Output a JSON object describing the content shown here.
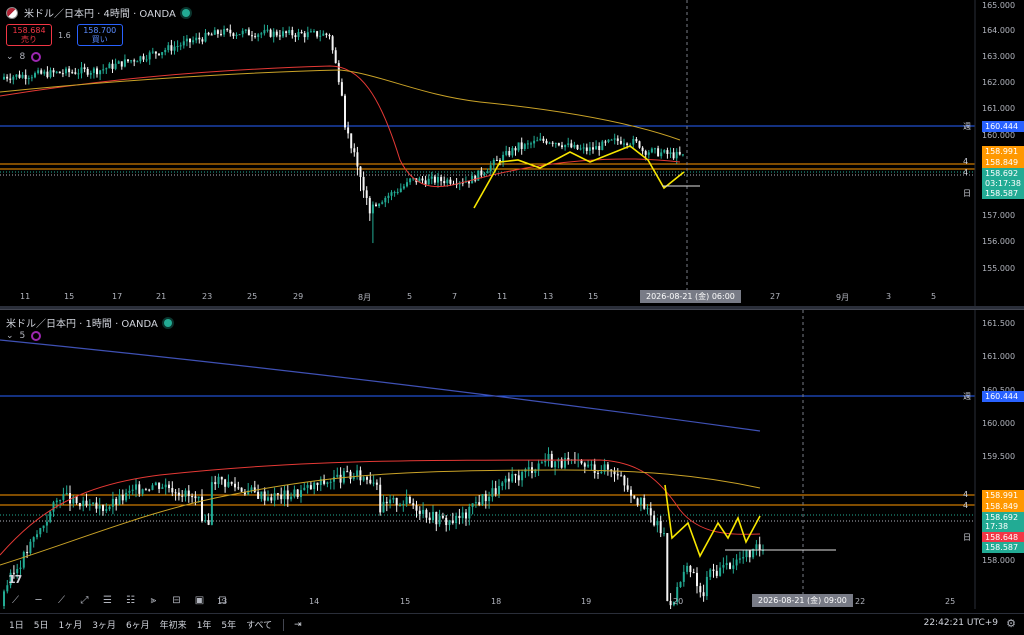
{
  "top_chart": {
    "title": "米ドル／日本円 · 4時間 · OANDA",
    "sell": {
      "price": "158.684",
      "label": "売り"
    },
    "spread": "1.6",
    "buy": {
      "price": "158.700",
      "label": "買い"
    },
    "indicator_count": "8",
    "price_axis": [
      "165.000",
      "164.000",
      "163.000",
      "162.000",
      "161.000",
      "160.000",
      "157.000",
      "156.000",
      "155.000"
    ],
    "time_axis": [
      "11",
      "15",
      "17",
      "21",
      "23",
      "25",
      "29",
      "8月",
      "5",
      "7",
      "11",
      "13",
      "15",
      "27",
      "9月",
      "3",
      "5"
    ],
    "crosshair_time": "2026-08-21 (金)  06:00",
    "price_tags": [
      {
        "label": "160.444",
        "color": "#2962ff",
        "marker": "週"
      },
      {
        "label": "158.991",
        "color": "#ff9800",
        "marker": ""
      },
      {
        "label": "158.849",
        "color": "#ff9800",
        "marker": "4"
      },
      {
        "label": "158.692",
        "color": "#22ab94",
        "marker": "4"
      },
      {
        "label": "03:17:38",
        "color": "#22ab94",
        "marker": ""
      },
      {
        "label": "158.587",
        "color": "#22ab94",
        "marker": "日"
      }
    ]
  },
  "bottom_chart": {
    "title": "米ドル／日本円 · 1時間 · OANDA",
    "indicator_count": "5",
    "price_axis": [
      "161.500",
      "161.000",
      "160.500",
      "160.000",
      "159.500",
      "158.000"
    ],
    "time_axis": [
      "13",
      "14",
      "15",
      "18",
      "19",
      "20",
      "22",
      "25"
    ],
    "crosshair_time": "2026-08-21 (金)  09:00",
    "price_tags": [
      {
        "label": "160.444",
        "color": "#2962ff",
        "marker": "週"
      },
      {
        "label": "158.991",
        "color": "#ff9800",
        "marker": "4"
      },
      {
        "label": "158.849",
        "color": "#ff9800",
        "marker": "4"
      },
      {
        "label": "158.692",
        "color": "#22ab94",
        "marker": ""
      },
      {
        "label": "17:38",
        "color": "#22ab94",
        "marker": ""
      },
      {
        "label": "158.648",
        "color": "#f23645",
        "marker": "日"
      },
      {
        "label": "158.587",
        "color": "#22ab94",
        "marker": ""
      }
    ]
  },
  "tools": [
    "crosshair-icon",
    "horizontal-line-icon",
    "trend-line-icon",
    "extended-line-icon",
    "fib-icon",
    "fib-channel-icon",
    "pitchfork-icon",
    "ruler-icon",
    "rectangle-icon",
    "range-icon"
  ],
  "ranges": [
    "1日",
    "5日",
    "1ヶ月",
    "3ヶ月",
    "6ヶ月",
    "年初来",
    "1年",
    "5年",
    "すべて"
  ],
  "clock": "22:42:21 UTC+9",
  "colors": {
    "up": "#22ab94",
    "down": "#f5f5f5",
    "ma_red": "#e53935",
    "ma_yellow": "#c9a227",
    "zigzag": "#f7e600"
  }
}
